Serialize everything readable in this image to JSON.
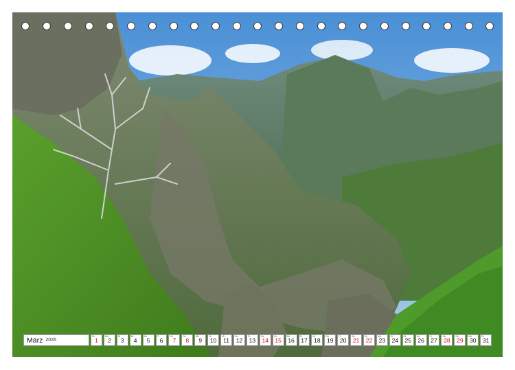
{
  "calendar": {
    "month": "März",
    "year": "2026",
    "days": [
      {
        "d": "1",
        "wd": "So",
        "red": true
      },
      {
        "d": "2",
        "wd": "Mo",
        "red": false
      },
      {
        "d": "3",
        "wd": "Di",
        "red": false
      },
      {
        "d": "4",
        "wd": "Mi",
        "red": false
      },
      {
        "d": "5",
        "wd": "Do",
        "red": false
      },
      {
        "d": "6",
        "wd": "Fr",
        "red": false
      },
      {
        "d": "7",
        "wd": "Sa",
        "red": true
      },
      {
        "d": "8",
        "wd": "So",
        "red": true
      },
      {
        "d": "9",
        "wd": "Mo",
        "red": false
      },
      {
        "d": "10",
        "wd": "Di",
        "red": false
      },
      {
        "d": "11",
        "wd": "Mi",
        "red": false
      },
      {
        "d": "12",
        "wd": "Do",
        "red": false
      },
      {
        "d": "13",
        "wd": "Fr",
        "red": false
      },
      {
        "d": "14",
        "wd": "Sa",
        "red": true
      },
      {
        "d": "15",
        "wd": "So",
        "red": true
      },
      {
        "d": "16",
        "wd": "Mo",
        "red": false
      },
      {
        "d": "17",
        "wd": "Di",
        "red": false
      },
      {
        "d": "18",
        "wd": "Mi",
        "red": false
      },
      {
        "d": "19",
        "wd": "Do",
        "red": false
      },
      {
        "d": "20",
        "wd": "Fr",
        "red": false
      },
      {
        "d": "21",
        "wd": "Sa",
        "red": true
      },
      {
        "d": "22",
        "wd": "So",
        "red": true
      },
      {
        "d": "23",
        "wd": "Mo",
        "red": false
      },
      {
        "d": "24",
        "wd": "Di",
        "red": false
      },
      {
        "d": "25",
        "wd": "Mi",
        "red": false
      },
      {
        "d": "26",
        "wd": "Do",
        "red": false
      },
      {
        "d": "27",
        "wd": "Fr",
        "red": false
      },
      {
        "d": "28",
        "wd": "Sa",
        "red": true
      },
      {
        "d": "29",
        "wd": "So",
        "red": true
      },
      {
        "d": "30",
        "wd": "Mo",
        "red": false
      },
      {
        "d": "31",
        "wd": "Di",
        "red": false
      }
    ]
  },
  "colors": {
    "weekend": "#c8102e",
    "text": "#111111"
  }
}
